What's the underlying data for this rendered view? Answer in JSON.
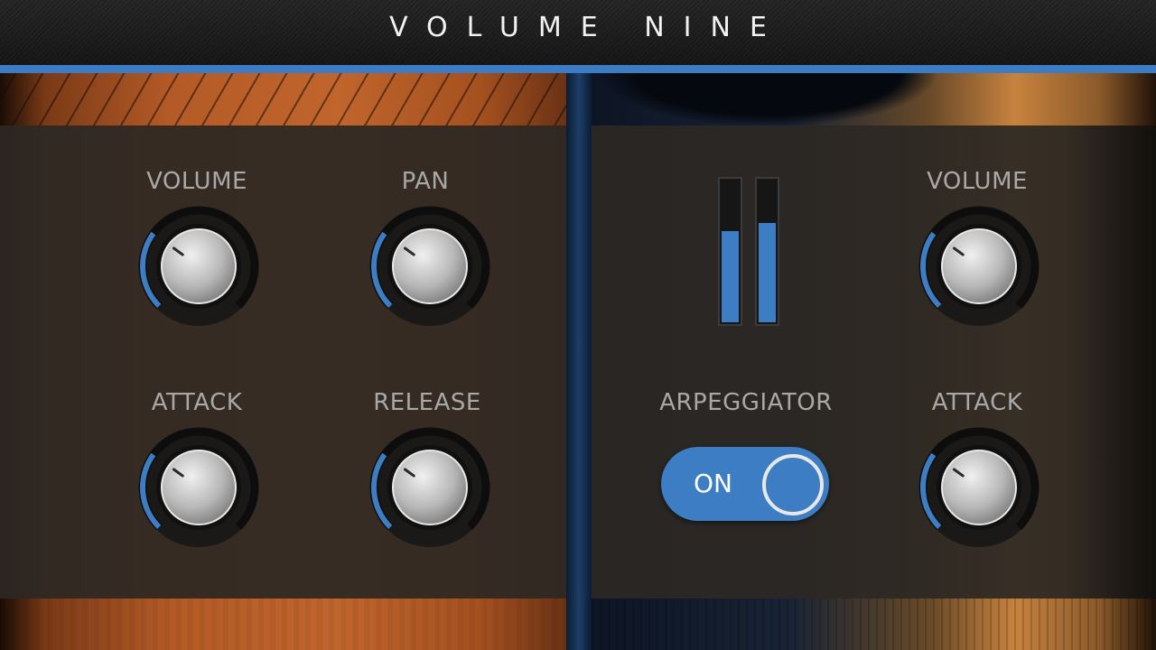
{
  "app": {
    "title": "VOLUME NINE"
  },
  "colors": {
    "accent": "#3d7dc3",
    "panel": "#2c2824",
    "label": "#a8a8a8"
  },
  "left_panel": {
    "knobs": [
      {
        "label": "VOLUME",
        "value": 0.3
      },
      {
        "label": "PAN",
        "value": 0.3
      },
      {
        "label": "ATTACK",
        "value": 0.3
      },
      {
        "label": "RELEASE",
        "value": 0.3
      }
    ]
  },
  "right_panel": {
    "meters": [
      {
        "name": "left",
        "level": 0.65
      },
      {
        "name": "right",
        "level": 0.71
      }
    ],
    "knobs": [
      {
        "label": "VOLUME",
        "value": 0.3
      },
      {
        "label": "ATTACK",
        "value": 0.3
      }
    ],
    "arpeggiator": {
      "label": "ARPEGGIATOR",
      "state": "ON"
    }
  }
}
